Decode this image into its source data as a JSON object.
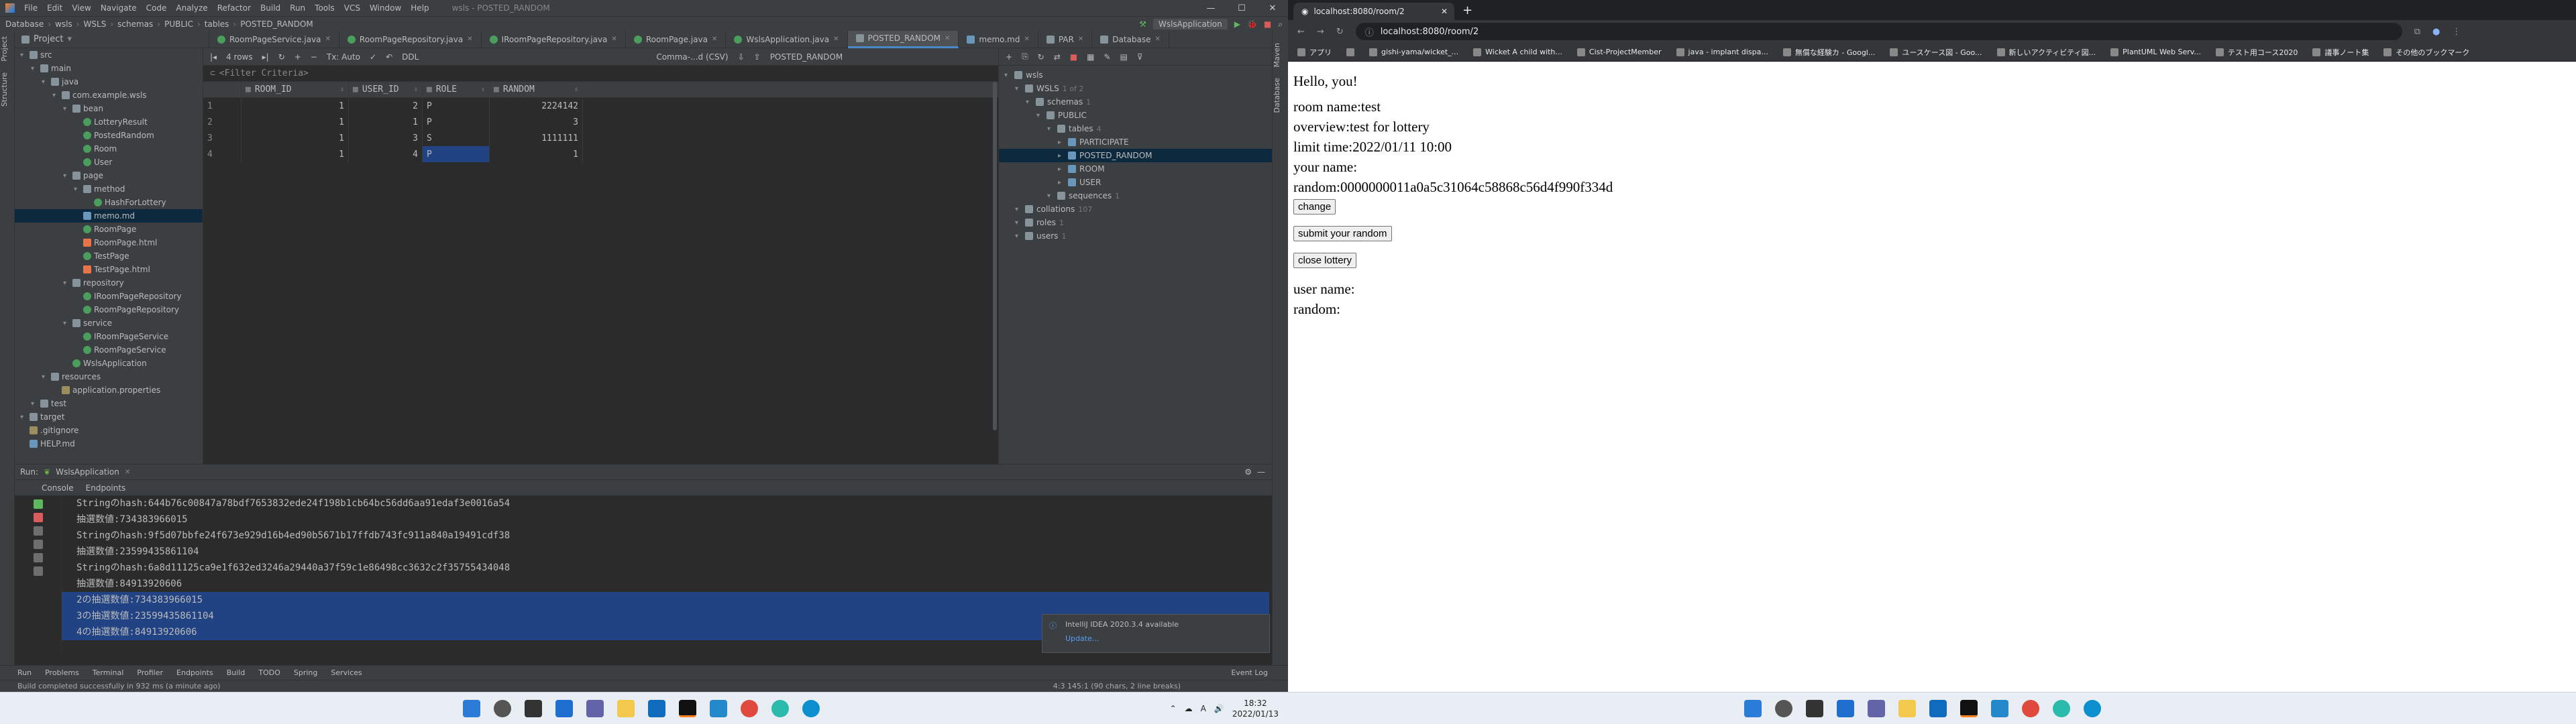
{
  "ide": {
    "menu": [
      "File",
      "Edit",
      "View",
      "Navigate",
      "Code",
      "Analyze",
      "Refactor",
      "Build",
      "Run",
      "Tools",
      "VCS",
      "Window",
      "Help"
    ],
    "window_title": "wsls - POSTED_RANDOM",
    "breadcrumb": [
      "Database",
      "wsls",
      "WSLS",
      "schemas",
      "PUBLIC",
      "tables",
      "POSTED_RANDOM"
    ],
    "run_config": "WslsApplication",
    "project_header": "Project",
    "tabs": [
      "RoomPageService.java",
      "RoomPageRepository.java",
      "IRoomPageRepository.java",
      "RoomPage.java",
      "WslsApplication.java",
      "POSTED_RANDOM",
      "memo.md",
      "PAR",
      "Database"
    ],
    "active_tab": "POSTED_RANDOM",
    "project_tree": [
      {
        "label": "src",
        "depth": 0,
        "type": "folder"
      },
      {
        "label": "main",
        "depth": 1,
        "type": "folder"
      },
      {
        "label": "java",
        "depth": 2,
        "type": "folder"
      },
      {
        "label": "com.example.wsls",
        "depth": 3,
        "type": "folder"
      },
      {
        "label": "bean",
        "depth": 4,
        "type": "folder"
      },
      {
        "label": "LotteryResult",
        "depth": 5,
        "type": "java"
      },
      {
        "label": "PostedRandom",
        "depth": 5,
        "type": "java"
      },
      {
        "label": "Room",
        "depth": 5,
        "type": "java"
      },
      {
        "label": "User",
        "depth": 5,
        "type": "java"
      },
      {
        "label": "page",
        "depth": 4,
        "type": "folder"
      },
      {
        "label": "method",
        "depth": 5,
        "type": "folder"
      },
      {
        "label": "HashForLottery",
        "depth": 6,
        "type": "java"
      },
      {
        "label": "memo.md",
        "depth": 5,
        "type": "md"
      },
      {
        "label": "RoomPage",
        "depth": 5,
        "type": "java"
      },
      {
        "label": "RoomPage.html",
        "depth": 5,
        "type": "html"
      },
      {
        "label": "TestPage",
        "depth": 5,
        "type": "java"
      },
      {
        "label": "TestPage.html",
        "depth": 5,
        "type": "html"
      },
      {
        "label": "repository",
        "depth": 4,
        "type": "folder"
      },
      {
        "label": "IRoomPageRepository",
        "depth": 5,
        "type": "java"
      },
      {
        "label": "RoomPageRepository",
        "depth": 5,
        "type": "java"
      },
      {
        "label": "service",
        "depth": 4,
        "type": "folder"
      },
      {
        "label": "IRoomPageService",
        "depth": 5,
        "type": "java"
      },
      {
        "label": "RoomPageService",
        "depth": 5,
        "type": "java"
      },
      {
        "label": "WslsApplication",
        "depth": 4,
        "type": "java"
      },
      {
        "label": "resources",
        "depth": 2,
        "type": "folder"
      },
      {
        "label": "application.properties",
        "depth": 3,
        "type": "prop"
      },
      {
        "label": "test",
        "depth": 1,
        "type": "folder"
      },
      {
        "label": "target",
        "depth": 0,
        "type": "folder"
      },
      {
        "label": ".gitignore",
        "depth": 0,
        "type": "prop"
      },
      {
        "label": "HELP.md",
        "depth": 0,
        "type": "md"
      }
    ],
    "db_toolbar": {
      "rows": "4 rows",
      "tx": "Tx: Auto",
      "ddl": "DDL",
      "output": "Comma-...d (CSV)",
      "table": "POSTED_RANDOM"
    },
    "filter_placeholder": "<Filter Criteria>",
    "grid": {
      "columns": [
        "ROOM_ID",
        "USER_ID",
        "ROLE",
        "RANDOM"
      ],
      "rows": [
        [
          "1",
          "1",
          "2",
          "P",
          "2224142"
        ],
        [
          "2",
          "1",
          "1",
          "P",
          "3"
        ],
        [
          "3",
          "1",
          "3",
          "S",
          "1111111"
        ],
        [
          "4",
          "1",
          "4",
          "P",
          "1"
        ]
      ]
    },
    "db_tree": [
      {
        "label": "wsls",
        "depth": 0,
        "note": ""
      },
      {
        "label": "WSLS",
        "depth": 1,
        "note": "1 of 2"
      },
      {
        "label": "schemas",
        "depth": 2,
        "note": "1"
      },
      {
        "label": "PUBLIC",
        "depth": 3,
        "note": ""
      },
      {
        "label": "tables",
        "depth": 4,
        "note": "4"
      },
      {
        "label": "PARTICIPATE",
        "depth": 5,
        "note": ""
      },
      {
        "label": "POSTED_RANDOM",
        "depth": 5,
        "note": ""
      },
      {
        "label": "ROOM",
        "depth": 5,
        "note": ""
      },
      {
        "label": "USER",
        "depth": 5,
        "note": ""
      },
      {
        "label": "sequences",
        "depth": 4,
        "note": "1"
      },
      {
        "label": "collations",
        "depth": 1,
        "note": "107"
      },
      {
        "label": "roles",
        "depth": 1,
        "note": "1"
      },
      {
        "label": "users",
        "depth": 1,
        "note": "1"
      }
    ],
    "run_label": "Run:",
    "run_config_tab": "WslsApplication",
    "run_tabs": [
      "Console",
      "Endpoints"
    ],
    "console_lines": [
      {
        "text": "Stringのhash:644b76c00847a78bdf7653832ede24f198b1cb64bc56dd6aa91edaf3e0016a54",
        "hl": false
      },
      {
        "text": "抽選数値:734383966015",
        "hl": false
      },
      {
        "text": "Stringのhash:9f5d07bbfe24f673e929d16b4ed90b5671b17ffdb743fc911a840a19491cdf38",
        "hl": false
      },
      {
        "text": "抽選数値:23599435861104",
        "hl": false
      },
      {
        "text": "Stringのhash:6a8d11125ca9e1f632ed3246a29440a37f59c1e86498cc3632c2f35755434048",
        "hl": false
      },
      {
        "text": "抽選数値:84913920606",
        "hl": false
      },
      {
        "text": "2の抽選数値:734383966015",
        "hl": true
      },
      {
        "text": "3の抽選数値:23599435861104",
        "hl": true
      },
      {
        "text": "4の抽選数値:84913920606",
        "hl": true
      }
    ],
    "notification": {
      "title": "IntelliJ IDEA 2020.3.4 available",
      "link": "Update..."
    },
    "bottom_tabs": [
      "Run",
      "Problems",
      "Terminal",
      "Profiler",
      "Endpoints",
      "Build",
      "TODO",
      "Spring",
      "Services"
    ],
    "event_log": "Event Log",
    "status_message": "Build completed successfully in 932 ms (a minute ago)",
    "status_right": "4:3   145:1 (90 chars, 2 line breaks)"
  },
  "browser": {
    "tab_title": "localhost:8080/room/2",
    "url": "localhost:8080/room/2",
    "bookmarks": [
      "アプリ",
      "",
      "gishi-yama/wicket_...",
      "Wicket A child with...",
      "Cist-ProjectMember",
      "java - implant dispa...",
      "無償な経験カ - Googl...",
      "ユースケース図 - Goo...",
      "新しいアクティビティ図...",
      "PlantUML Web Serv...",
      "テスト用コース2020",
      "議事ノート集",
      "その他のブックマーク"
    ],
    "page": {
      "greeting": "Hello, you!",
      "room_name": "room name:test",
      "overview": "overview:test for lottery",
      "limit": "limit time:2022/01/11 10:00",
      "your_name": "your name:",
      "random": "random:0000000011a0a5c31064c58868c56d4f990f334d",
      "change_btn": "change",
      "submit_btn": "submit your random",
      "close_btn": "close lottery",
      "user_name": "user name:",
      "random2": "random:"
    }
  },
  "taskbar": {
    "time": "18:32",
    "date": "2022/01/13",
    "lang": "A"
  }
}
